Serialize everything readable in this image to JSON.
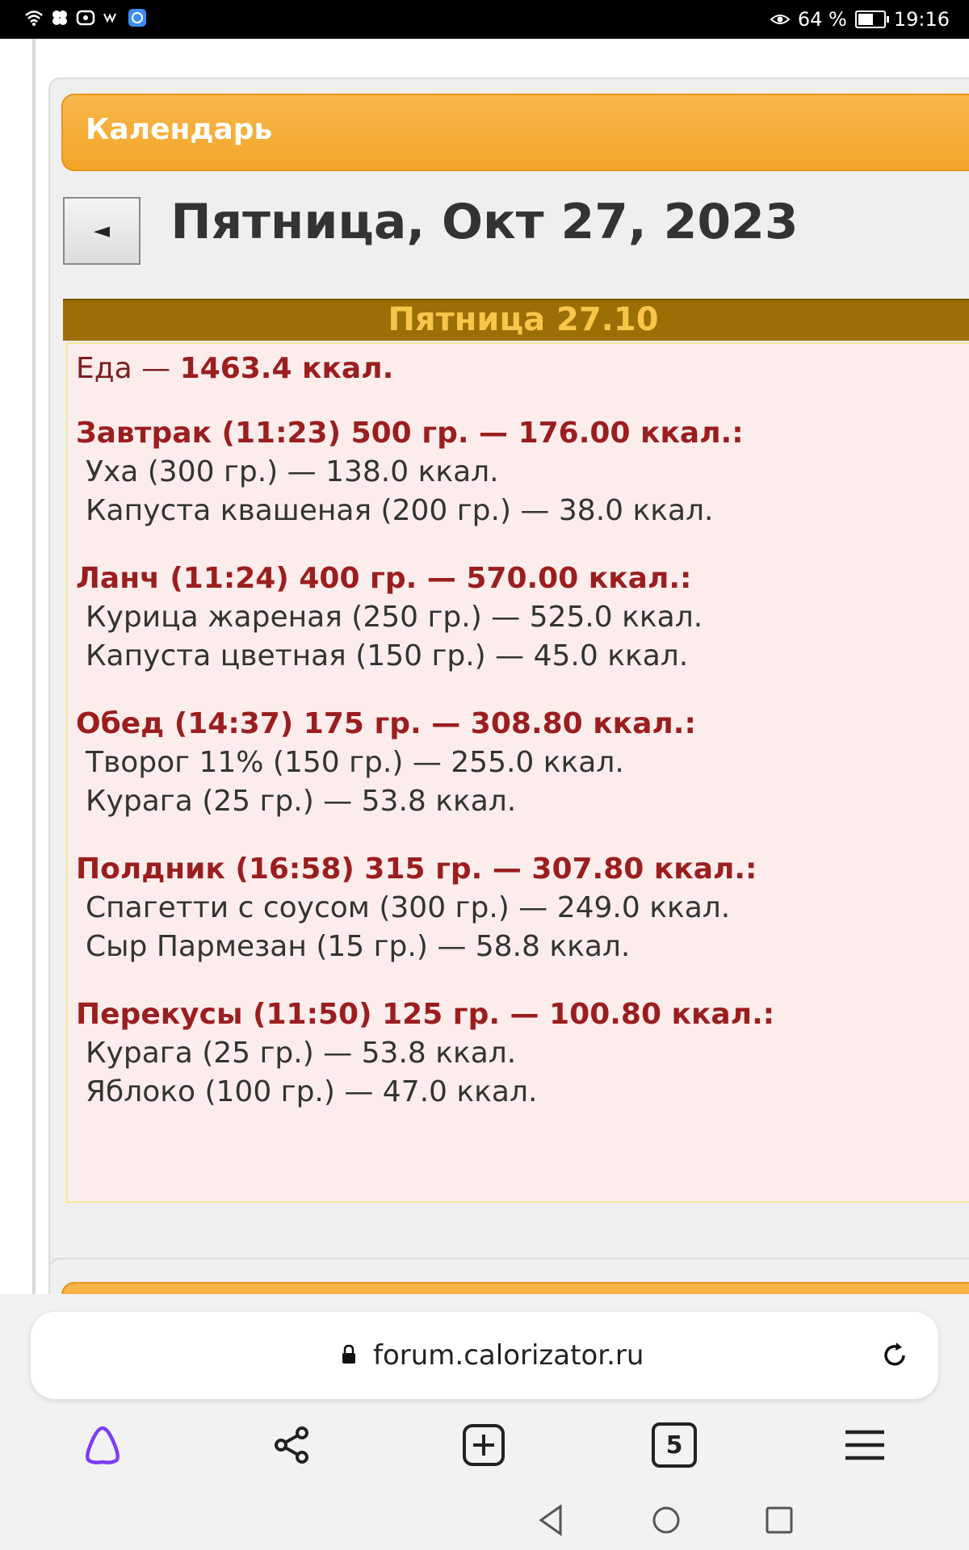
{
  "status_bar": {
    "battery": "64 %",
    "time": "19:16"
  },
  "calendar": {
    "title": "Календарь",
    "prev_label": "◄",
    "date_heading": "Пятница, Окт 27, 2023",
    "day_header": "Пятница 27.10",
    "total_label": "Еда — ",
    "total_value": "1463.4 ккал.",
    "meals": [
      {
        "title": "Завтрак (11:23) 500 гр. — 176.00 ккал.:",
        "items": [
          "Уха (300 гр.) — 138.0 ккал.",
          "Капуста квашеная (200 гр.) — 38.0 ккал."
        ]
      },
      {
        "title": "Ланч (11:24) 400 гр. — 570.00 ккал.:",
        "items": [
          "Курица жареная (250 гр.) — 525.0 ккал.",
          "Капуста цветная (150 гр.) — 45.0 ккал."
        ]
      },
      {
        "title": "Обед (14:37) 175 гр. — 308.80 ккал.:",
        "items": [
          "Творог 11% (150 гр.) — 255.0 ккал.",
          "Курага (25 гр.) — 53.8 ккал."
        ]
      },
      {
        "title": "Полдник (16:58) 315 гр. — 307.80 ккал.:",
        "items": [
          "Спагетти с соусом (300 гр.) — 249.0 ккал.",
          "Сыр Пармезан (15 гр.) — 58.8 ккал."
        ]
      },
      {
        "title": "Перекусы (11:50) 125 гр. — 100.80 ккал.:",
        "items": [
          "Курага (25 гр.) — 53.8 ккал.",
          "Яблоко (100 гр.) — 47.0 ккал."
        ]
      }
    ]
  },
  "browser": {
    "url": "forum.calorizator.ru",
    "tab_count": "5"
  },
  "colors": {
    "accent_orange": "#f3a527",
    "day_header_bg": "#9b6f05",
    "meal_title": "#9b1e1e",
    "alice_purple": "#7d3cf0"
  }
}
